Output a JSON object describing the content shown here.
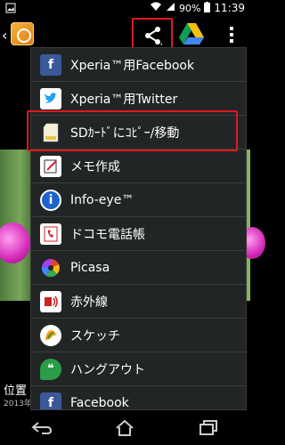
{
  "status_bar": {
    "battery": "90%",
    "time": "11:39"
  },
  "caption": {
    "title": "位置",
    "subtitle": "2013年"
  },
  "menu": {
    "items": [
      {
        "label": "Xperia™用Facebook",
        "icon": "facebook-icon",
        "color": "#3b5998"
      },
      {
        "label": "Xperia™用Twitter",
        "icon": "twitter-icon",
        "color": "#ffffff"
      },
      {
        "label": "SDｶｰﾄﾞにｺﾋﾟｰ/移動",
        "icon": "sdcard-icon",
        "color": "#ffffff"
      },
      {
        "label": "メモ作成",
        "icon": "memo-icon",
        "color": "#ffffff"
      },
      {
        "label": "Info-eye™",
        "icon": "info-eye-icon",
        "color": "#1e63c9"
      },
      {
        "label": "ドコモ電話帳",
        "icon": "phonebook-icon",
        "color": "#ffffff"
      },
      {
        "label": "Picasa",
        "icon": "picasa-icon",
        "color": "#ffffff"
      },
      {
        "label": "赤外線",
        "icon": "infrared-icon",
        "color": "#ffffff"
      },
      {
        "label": "スケッチ",
        "icon": "sketch-icon",
        "color": "#ffffff"
      },
      {
        "label": "ハングアウト",
        "icon": "hangouts-icon",
        "color": "#2a9d46"
      },
      {
        "label": "Facebook",
        "icon": "facebook-icon",
        "color": "#3b5998"
      }
    ]
  }
}
